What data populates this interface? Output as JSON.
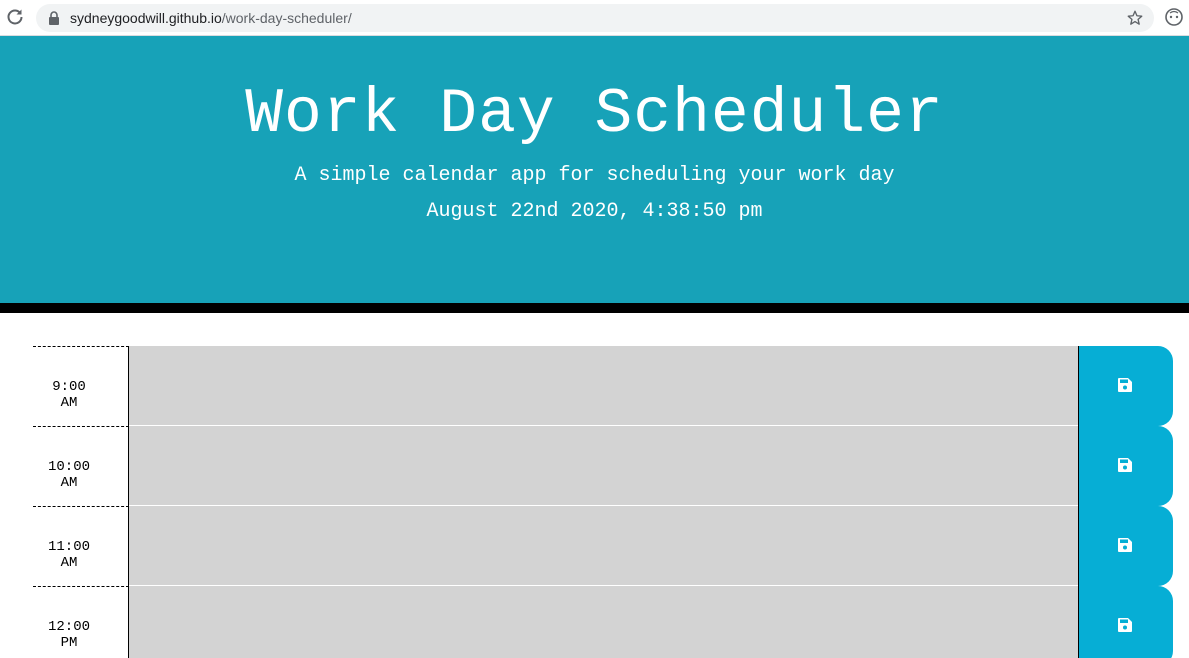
{
  "browser": {
    "url_host": "sydneygoodwill.github.io",
    "url_path": "/work-day-scheduler/"
  },
  "header": {
    "title": "Work Day Scheduler",
    "lead": "A simple calendar app for scheduling your work day",
    "current_day": "August 22nd 2020, 4:38:50 pm"
  },
  "colors": {
    "jumbotron": "#17a2b8",
    "past": "#d3d3d3",
    "save_button": "#06aed5"
  },
  "timeblocks": [
    {
      "time": "9:00",
      "period": "AM",
      "description": ""
    },
    {
      "time": "10:00",
      "period": "AM",
      "description": ""
    },
    {
      "time": "11:00",
      "period": "AM",
      "description": ""
    },
    {
      "time": "12:00",
      "period": "PM",
      "description": ""
    }
  ],
  "icons": {
    "reload": "reload-icon",
    "lock": "lock-icon",
    "star": "bookmark-star-icon",
    "profile": "profile-icon",
    "save": "floppy-disk-icon"
  }
}
